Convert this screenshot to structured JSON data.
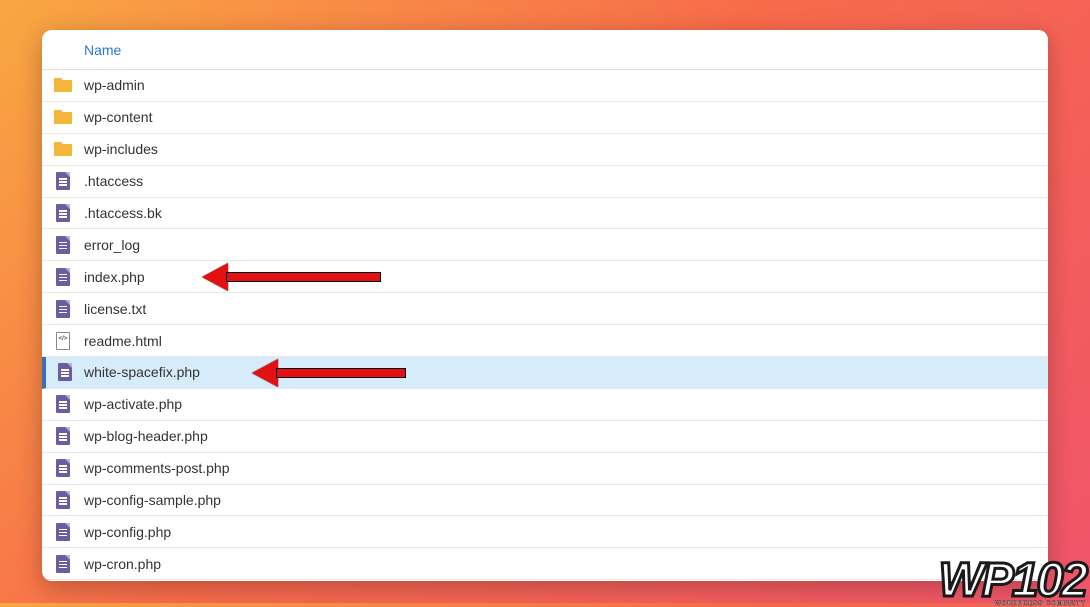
{
  "header": {
    "name_column": "Name"
  },
  "files": [
    {
      "name": "wp-admin",
      "type": "folder",
      "selected": false,
      "arrow": false
    },
    {
      "name": "wp-content",
      "type": "folder",
      "selected": false,
      "arrow": false
    },
    {
      "name": "wp-includes",
      "type": "folder",
      "selected": false,
      "arrow": false
    },
    {
      "name": ".htaccess",
      "type": "doc",
      "selected": false,
      "arrow": false
    },
    {
      "name": ".htaccess.bk",
      "type": "doc",
      "selected": false,
      "arrow": false
    },
    {
      "name": "error_log",
      "type": "doc",
      "selected": false,
      "arrow": false
    },
    {
      "name": "index.php",
      "type": "doc",
      "selected": false,
      "arrow": true
    },
    {
      "name": "license.txt",
      "type": "doc",
      "selected": false,
      "arrow": false
    },
    {
      "name": "readme.html",
      "type": "code",
      "selected": false,
      "arrow": false
    },
    {
      "name": "white-spacefix.php",
      "type": "doc",
      "selected": true,
      "arrow": true
    },
    {
      "name": "wp-activate.php",
      "type": "doc",
      "selected": false,
      "arrow": false
    },
    {
      "name": "wp-blog-header.php",
      "type": "doc",
      "selected": false,
      "arrow": false
    },
    {
      "name": "wp-comments-post.php",
      "type": "doc",
      "selected": false,
      "arrow": false
    },
    {
      "name": "wp-config-sample.php",
      "type": "doc",
      "selected": false,
      "arrow": false
    },
    {
      "name": "wp-config.php",
      "type": "doc",
      "selected": false,
      "arrow": false
    },
    {
      "name": "wp-cron.php",
      "type": "doc",
      "selected": false,
      "arrow": false
    }
  ],
  "watermark": {
    "main": "WP102",
    "sub": "WORDPRESS COMUNITY"
  },
  "colors": {
    "gradient_start": "#f9a742",
    "gradient_mid": "#f76b4a",
    "gradient_end": "#f0546a",
    "link_blue": "#2979d1",
    "arrow_red": "#e31111",
    "selection": "#d6ecfa"
  }
}
